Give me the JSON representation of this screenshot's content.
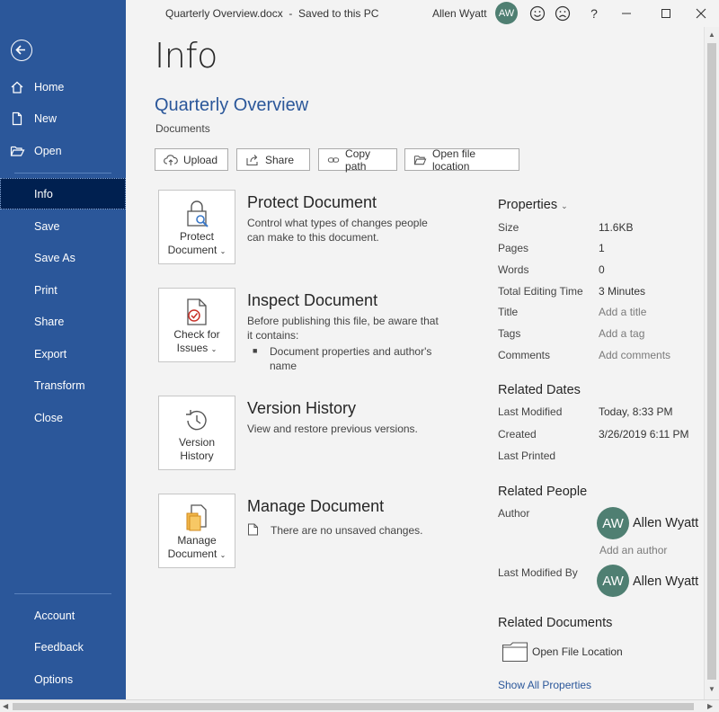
{
  "window": {
    "title": "Quarterly Overview.docx  -  Saved to this PC",
    "user_name": "Allen Wyatt",
    "user_initials": "AW",
    "help": "?"
  },
  "sidebar": {
    "top_items": [
      {
        "label": "Home",
        "icon": "home-icon"
      },
      {
        "label": "New",
        "icon": "new-document-icon"
      },
      {
        "label": "Open",
        "icon": "open-folder-icon"
      }
    ],
    "items": [
      "Info",
      "Save",
      "Save As",
      "Print",
      "Share",
      "Export",
      "Transform",
      "Close"
    ],
    "active": "Info",
    "bottom_items": [
      "Account",
      "Feedback",
      "Options"
    ]
  },
  "main": {
    "page_title": "Info",
    "doc_name": "Quarterly Overview",
    "doc_location": "Documents",
    "actions": [
      {
        "label": "Upload",
        "icon": "upload-cloud-icon"
      },
      {
        "label": "Share",
        "icon": "share-icon"
      },
      {
        "label": "Copy path",
        "icon": "link-icon"
      },
      {
        "label": "Open file location",
        "icon": "folder-icon"
      }
    ],
    "sections": {
      "protect": {
        "button_line1": "Protect",
        "button_line2": "Document",
        "title": "Protect Document",
        "desc": "Control what types of changes people can make to this document."
      },
      "inspect": {
        "button_line1": "Check for",
        "button_line2": "Issues",
        "title": "Inspect Document",
        "desc": "Before publishing this file, be aware that it contains:",
        "bullet": "Document properties and author's name"
      },
      "history": {
        "button_line1": "Version",
        "button_line2": "History",
        "title": "Version History",
        "desc": "View and restore previous versions."
      },
      "manage": {
        "button_line1": "Manage",
        "button_line2": "Document",
        "title": "Manage Document",
        "desc": "There are no unsaved changes."
      }
    }
  },
  "properties": {
    "heading": "Properties",
    "rows": {
      "size": {
        "key": "Size",
        "value": "11.6KB"
      },
      "pages": {
        "key": "Pages",
        "value": "1"
      },
      "words": {
        "key": "Words",
        "value": "0"
      },
      "editing": {
        "key": "Total Editing Time",
        "value": "3 Minutes"
      },
      "title": {
        "key": "Title",
        "value": "Add a title"
      },
      "tags": {
        "key": "Tags",
        "value": "Add a tag"
      },
      "comments": {
        "key": "Comments",
        "value": "Add comments"
      }
    },
    "related_dates": {
      "heading": "Related Dates",
      "last_modified": {
        "key": "Last Modified",
        "value": "Today, 8:33 PM"
      },
      "created": {
        "key": "Created",
        "value": "3/26/2019 6:11 PM"
      },
      "last_printed": {
        "key": "Last Printed",
        "value": ""
      }
    },
    "related_people": {
      "heading": "Related People",
      "author_key": "Author",
      "author_name": "Allen Wyatt",
      "author_initials": "AW",
      "add_author": "Add an author",
      "last_modified_by_key": "Last Modified By",
      "last_modified_by_name": "Allen Wyatt",
      "last_modified_by_initials": "AW"
    },
    "related_documents": {
      "heading": "Related Documents",
      "open_location": "Open File Location"
    },
    "show_all": "Show All Properties"
  }
}
